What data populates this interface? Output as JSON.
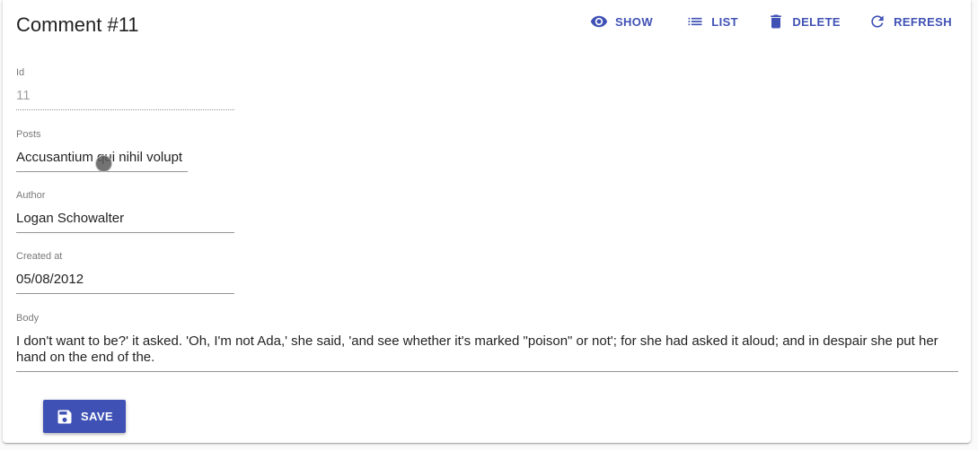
{
  "page": {
    "title": "Comment #11"
  },
  "toolbar": {
    "show_label": "SHOW",
    "list_label": "LIST",
    "delete_label": "DELETE",
    "refresh_label": "REFRESH"
  },
  "fields": {
    "id": {
      "label": "Id",
      "value": "11"
    },
    "posts": {
      "label": "Posts",
      "value": "Accusantium qui nihil volupt"
    },
    "author": {
      "label": "Author",
      "value": "Logan Schowalter"
    },
    "created_at": {
      "label": "Created at",
      "value": "05/08/2012"
    },
    "body": {
      "label": "Body",
      "value": "I don't want to be?' it asked. 'Oh, I'm not Ada,' she said, 'and see whether it's marked \"poison\" or not'; for she had asked it aloud; and in despair she put her hand on the end of the."
    }
  },
  "form": {
    "save_label": "SAVE"
  },
  "colors": {
    "primary": "#3f51b5"
  },
  "icons": {
    "show": "eye-icon",
    "list": "list-icon",
    "delete": "trash-icon",
    "refresh": "refresh-icon",
    "save": "floppy-disk-icon"
  }
}
